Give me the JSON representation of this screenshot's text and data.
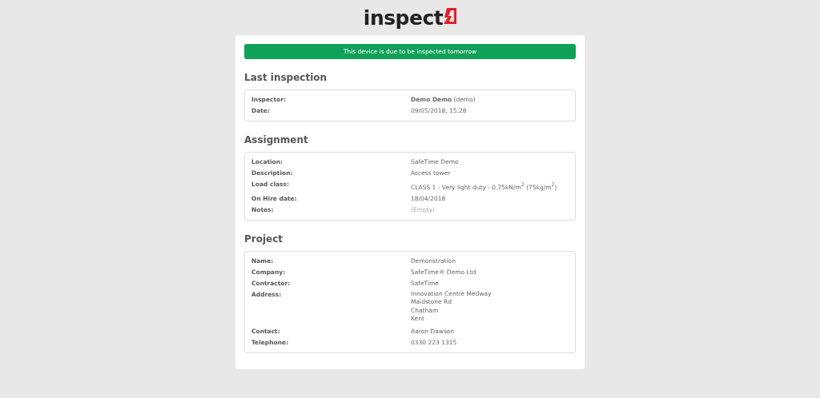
{
  "logo": {
    "text": "inspect"
  },
  "banner": "This device is due to be inspected tomorrow",
  "sections": [
    {
      "title": "Last inspection",
      "rows": [
        {
          "label": "Inspector:",
          "kind": "text",
          "value": "**Demo Demo** (demo)"
        },
        {
          "label": "Date:",
          "kind": "text",
          "value": "09/05/2018, 15:28"
        }
      ]
    },
    {
      "title": "Assignment",
      "rows": [
        {
          "label": "Location:",
          "kind": "text",
          "value": "SafeTime Demo"
        },
        {
          "label": "Description:",
          "kind": "text",
          "value": "Access tower"
        },
        {
          "label": "Load class:",
          "kind": "text",
          "value": "CLASS 1 - Very light duty - 0.75kN/m$^{2}$ (75kg/m$^{2}$)"
        },
        {
          "label": "On Hire date:",
          "kind": "text",
          "value": "18/04/2018"
        },
        {
          "label": "Notes:",
          "kind": "empty",
          "value": "(Empty)"
        }
      ]
    },
    {
      "title": "Project",
      "rows": [
        {
          "label": "Name:",
          "kind": "text",
          "value": "Demonstration"
        },
        {
          "label": "Company:",
          "kind": "text",
          "value": "SafeTime® Demo Ltd"
        },
        {
          "label": "Contractor:",
          "kind": "text",
          "value": "SafeTime"
        },
        {
          "label": "Address:",
          "kind": "multiline",
          "lines": [
            "Innovation Centre Medway",
            "Maidstone Rd",
            "Chatham",
            "Kent"
          ]
        },
        {
          "label": "Contact:",
          "kind": "text",
          "value": "Aaron Dawson"
        },
        {
          "label": "Telephone:",
          "kind": "text",
          "value": "0330 223 1315"
        }
      ]
    }
  ]
}
